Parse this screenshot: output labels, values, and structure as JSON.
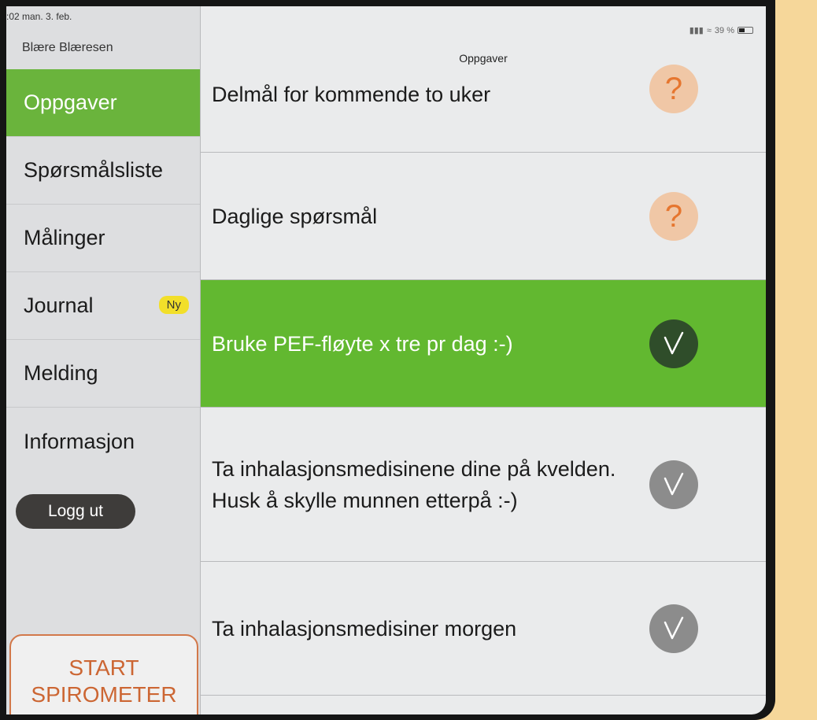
{
  "status": {
    "time_date": ":02  man. 3. feb.",
    "battery": "39 %"
  },
  "sidebar": {
    "user_name": "Blære Blæresen",
    "items": [
      {
        "label": "Oppgaver"
      },
      {
        "label": "Spørsmålsliste"
      },
      {
        "label": "Målinger"
      },
      {
        "label": "Journal",
        "badge": "Ny"
      },
      {
        "label": "Melding"
      },
      {
        "label": "Informasjon"
      }
    ],
    "logout_label": "Logg ut",
    "start_line1": "START",
    "start_line2": "SPIROMETER"
  },
  "main": {
    "title": "Oppgaver",
    "tasks": [
      {
        "label": "Delmål for kommende to uker",
        "icon": "question-icon"
      },
      {
        "label": "Daglige spørsmål",
        "icon": "question-icon"
      },
      {
        "label": "Bruke PEF-fløyte x tre pr dag :-)",
        "icon": "check-icon"
      },
      {
        "label": "Ta inhalasjonsmedisinene dine på kvelden. Husk å skylle munnen etterpå :-)",
        "icon": "check-icon"
      },
      {
        "label": "Ta inhalasjonsmedisiner morgen",
        "icon": "check-icon"
      }
    ]
  },
  "colors": {
    "accent_green": "#6ab43c",
    "badge_yellow": "#f2df2a",
    "start_orange": "#cc6633",
    "question_orange": "#e6762f"
  }
}
